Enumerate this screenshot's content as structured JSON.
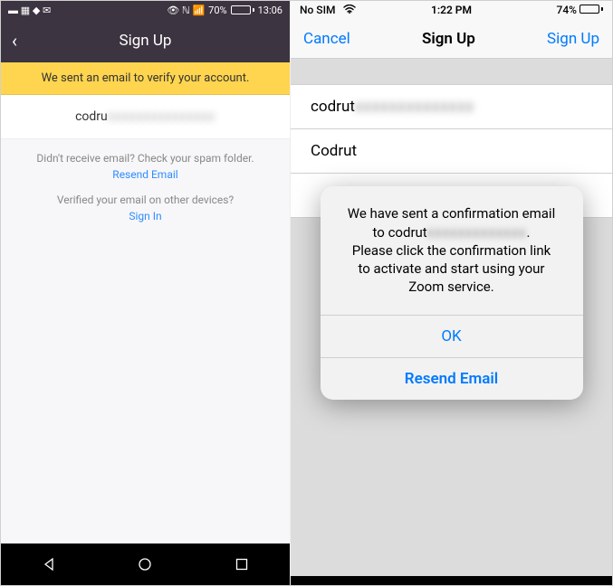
{
  "left": {
    "status": {
      "left_icons": "▬ ▦ ◆ ✉",
      "right_icons_prefix": "👁 ℕ 📶",
      "battery_pct": "70%",
      "time": "13:06"
    },
    "header": {
      "back": "‹",
      "title": "Sign Up"
    },
    "banner": "We sent an email to verify your account.",
    "email_prefix": "codru",
    "email_blur": "xxxxxxxxxxxxxxx",
    "spam_msg": "Didn't receive email? Check your spam folder.",
    "resend_link": "Resend Email",
    "verified_msg": "Verified your email on other devices?",
    "signin_link": "Sign In"
  },
  "right": {
    "status": {
      "carrier": "No SIM",
      "wifi": "📶",
      "time": "1:22 PM",
      "battery_pct": "74%"
    },
    "header": {
      "cancel": "Cancel",
      "title": "Sign Up",
      "action": "Sign Up"
    },
    "row1_prefix": "codrut",
    "row1_blur": "xxxxxxxxxxxxxx",
    "row2": "Codrut",
    "alert": {
      "line1": "We have sent a confirmation email",
      "line2_prefix": "to codrut",
      "line2_blur": "xxxxxxxxxxxxx",
      "line2_suffix": ".",
      "line3": "Please click the confirmation link",
      "line4": "to activate and start using your",
      "line5": "Zoom service.",
      "ok": "OK",
      "resend": "Resend Email"
    }
  }
}
